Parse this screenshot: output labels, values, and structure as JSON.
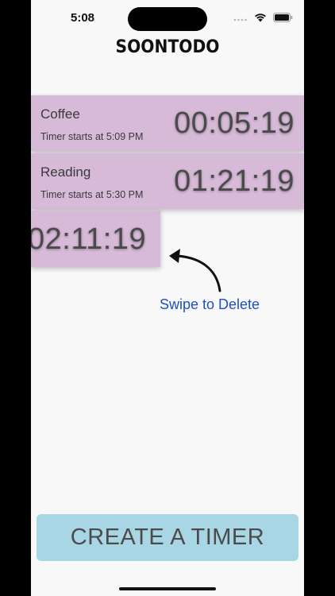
{
  "status_bar": {
    "time": "5:08",
    "icons": [
      "signal-icon",
      "wifi-icon",
      "battery-icon"
    ]
  },
  "app": {
    "title": "SOONTODO"
  },
  "timers": [
    {
      "name": "Coffee",
      "subtitle": "Timer starts at 5:09 PM",
      "countdown": "00:05:19"
    },
    {
      "name": "Reading",
      "subtitle": "Timer starts at 5:30 PM",
      "countdown": "01:21:19"
    },
    {
      "countdown": "02:11:19"
    }
  ],
  "hint": {
    "text": "Swipe to Delete",
    "color": "#1f4fc4"
  },
  "create_button": {
    "label": "CREATE A TIMER",
    "color": "#a9d6e5"
  },
  "colors": {
    "row_background": "#d7bad8",
    "screen_background": "#f8f8f8"
  }
}
